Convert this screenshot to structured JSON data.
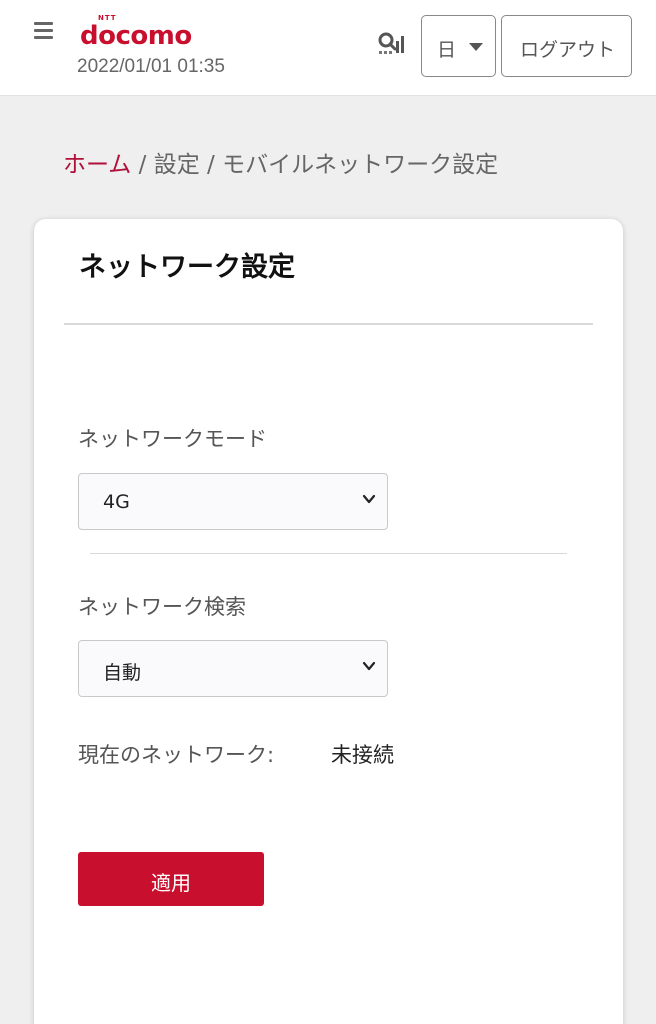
{
  "header": {
    "logo_ntt": "NTT",
    "logo_text": "docomo",
    "datetime": "2022/01/01 01:35",
    "language": "日",
    "logout_label": "ログアウト"
  },
  "breadcrumb": {
    "home": "ホーム",
    "separator": " / ",
    "settings": "設定",
    "current": "モバイルネットワーク設定"
  },
  "card": {
    "title": "ネットワーク設定",
    "network_mode": {
      "label": "ネットワークモード",
      "selected": "4G"
    },
    "network_search": {
      "label": "ネットワーク検索",
      "selected": "自動"
    },
    "current_network": {
      "label": "現在のネットワーク:",
      "value": "未接続"
    },
    "apply_label": "適用"
  },
  "icons": {
    "menu": "hamburger-menu-icon",
    "signal": "signal-search-icon",
    "caret": "caret-down-icon",
    "chevron": "chevron-down-icon"
  },
  "colors": {
    "brand": "#c8102e",
    "breadcrumb_link": "#b0103a",
    "background": "#efefef"
  }
}
